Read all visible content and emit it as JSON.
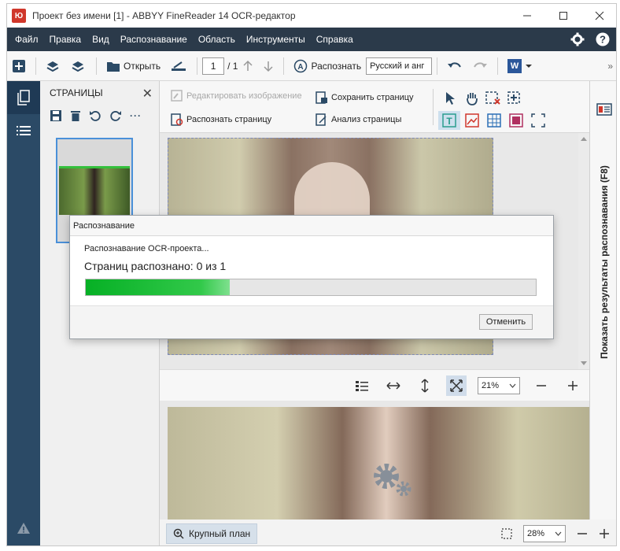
{
  "window": {
    "title": "Проект без имени [1] - ABBYY FineReader 14 OCR-редактор",
    "logo_text": "Ю"
  },
  "menu": {
    "items": [
      "Файл",
      "Правка",
      "Вид",
      "Распознавание",
      "Область",
      "Инструменты",
      "Справка"
    ]
  },
  "toolbar": {
    "open_label": "Открыть",
    "page_current": "1",
    "page_total": "/ 1",
    "recognize_label": "Распознать",
    "language": "Русский и анг",
    "word_label": "W"
  },
  "pages_panel": {
    "title": "СТРАНИЦЫ"
  },
  "editor_tools": {
    "edit_image": "Редактировать изображение",
    "recognize_page": "Распознать страницу",
    "save_page": "Сохранить страницу",
    "analyze_page": "Анализ страницы"
  },
  "zoom": {
    "image_zoom": "21%",
    "closeup_zoom": "28%",
    "closeup_label": "Крупный план"
  },
  "right_panel": {
    "label": "Показать результаты распознавания (F8)"
  },
  "dialog": {
    "title": "Распознавание",
    "status": "Распознавание OCR-проекта...",
    "count_text": "Страниц распознано: 0 из 1",
    "progress_fraction": 0.32,
    "cancel_label": "Отменить"
  },
  "colors": {
    "menubar": "#2b3a4a",
    "leftrail": "#2b4a66",
    "progress": "#06b025",
    "accent": "#4a90d9"
  }
}
